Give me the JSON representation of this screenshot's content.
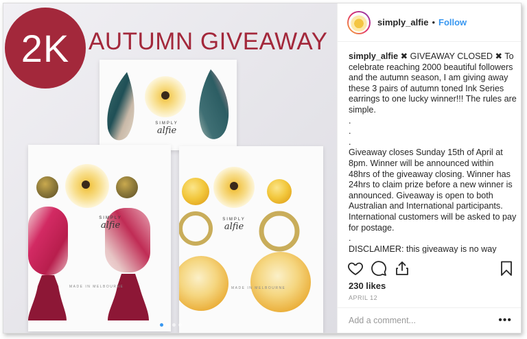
{
  "photo": {
    "badge_text": "2K",
    "headline": "AUTUMN GIVEAWAY",
    "brand_small": "SIMPLY",
    "brand_script": "alfie",
    "made_in": "MADE IN MELBOURNE",
    "carousel": {
      "count": 4,
      "active": 1
    }
  },
  "post": {
    "username": "simply_alfie",
    "separator": "•",
    "follow_label": "Follow",
    "caption_user": "simply_alfie",
    "caption_lines": [
      "✖ GIVEAWAY CLOSED ✖ To celebrate reaching 2000 beautiful followers and the autumn season, I am giving away these 3 pairs of autumn toned Ink Series earrings to one lucky winner!!! The rules are simple.",
      ".",
      ".",
      ".",
      "Giveaway closes Sunday 15th of April at 8pm. Winner will be announced within 48hrs of the giveaway closing. Winner has 24hrs to claim prize before a new winner is announced. Giveaway is open to both Australian and International participants. International customers will be asked to pay for postage.",
      ".",
      "DISCLAIMER: this giveaway is no way endorsed, administered or sponsored by"
    ],
    "likes": "230 likes",
    "date": "APRIL 12",
    "comment_placeholder": "Add a comment...",
    "more_label": "•••"
  },
  "icons": {
    "like": "heart-icon",
    "comment": "speech-bubble-icon",
    "share": "share-icon",
    "save": "bookmark-icon"
  },
  "colors": {
    "accent": "#a3283b",
    "link": "#3897f0"
  }
}
